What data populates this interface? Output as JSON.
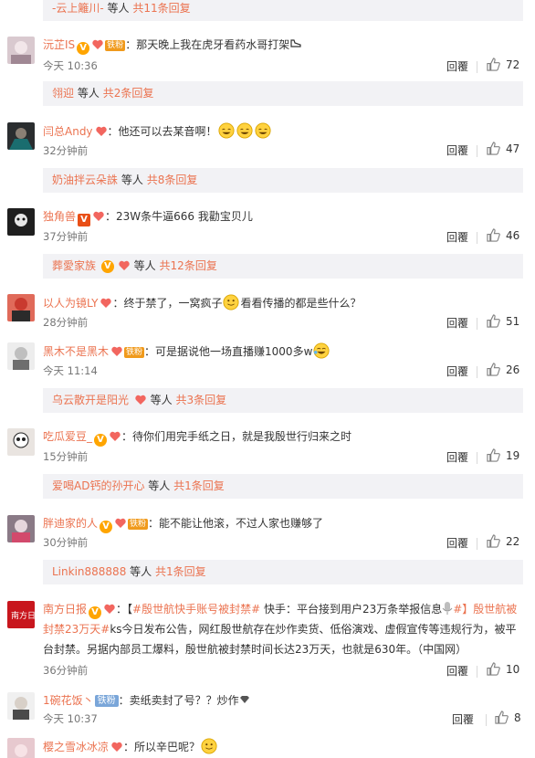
{
  "reply_label": "回覆",
  "more_replies_prefix": "共",
  "more_replies_suffix": "条回复",
  "others_word": "等人",
  "colors": {
    "accent": "#eb7350",
    "subbg": "#f2f2f5",
    "meta": "#777777"
  },
  "subthreads": [
    {
      "user": "-云上籬川-",
      "count": "11"
    },
    {
      "user": "翎迎",
      "count": "2"
    },
    {
      "user": "奶油拌云朵誅",
      "count": "8"
    },
    {
      "user": "葬愛家族",
      "count": "12"
    },
    {
      "user": "乌云散开是阳光",
      "count": "3"
    },
    {
      "user": "爱喝AD钙的孙开心",
      "count": "1"
    },
    {
      "user": "Linkin888888",
      "count": "1"
    }
  ],
  "comments": [
    {
      "user": "沅芷IS",
      "badge_text": "铁粉",
      "text": "：那天晚上我在虎牙看药水哥打架",
      "time": "今天 10:36",
      "likes": "72"
    },
    {
      "user": "闫总Andy",
      "text": "：他还可以去某音啊！",
      "time": "32分钟前",
      "likes": "47"
    },
    {
      "user": "独角兽",
      "text": "：23W条牛逼666 我勸宝贝儿",
      "time": "37分钟前",
      "likes": "46"
    },
    {
      "user": "以人为镜LY",
      "text_a": "：终于禁了，一窝疯子",
      "text_b": "看看传播的都是些什么？",
      "time": "28分钟前",
      "likes": "51"
    },
    {
      "user": "黑木不是黑木",
      "badge_text": "铁粉",
      "text": "：可是据说他一场直播赚1000多w",
      "time": "今天 11:14",
      "likes": "26"
    },
    {
      "user": "吃瓜爱豆_",
      "text": "：待你们用完手纸之日，就是我殷世行归来之时",
      "time": "15分钟前",
      "likes": "19"
    },
    {
      "user": "胖迪家的人",
      "badge_text": "铁粉",
      "text": "：能不能让他滚，不过人家也赚够了",
      "time": "30分钟前",
      "likes": "22"
    },
    {
      "user": "南方日报",
      "text_prefix": "：【",
      "hashtag1": "#殷世航快手账号被封禁#",
      "text_mid": " 快手：平台接到用户23万条举报信息",
      "hashtag2": "#】殷世航被封禁23万天#",
      "text_rest": "ks今日发布公告，网红殷世航存在炒作卖货、低俗演戏、虚假宣传等违规行为，被平台封禁。另据内部员工爆料，殷世航被封禁时间长达23万天，也就是630年。（中国网）",
      "time": "36分钟前",
      "likes": "10"
    },
    {
      "user": "1碗花饭丶",
      "badge_text": "铁粉",
      "text": "：卖纸卖封了号？？炒作",
      "time": "今天 10:37",
      "likes": "8"
    },
    {
      "user": "樱之雪冰冰凉",
      "text": "：所以辛巴呢？"
    }
  ]
}
